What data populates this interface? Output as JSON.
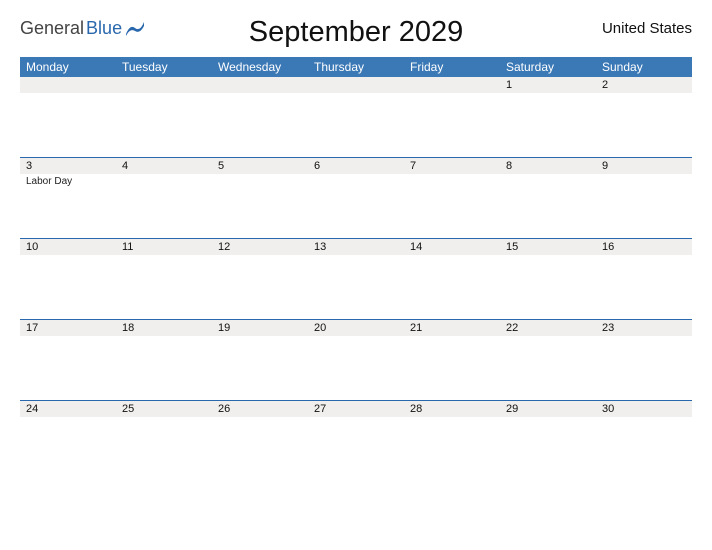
{
  "brand": {
    "part1": "General",
    "part2": "Blue"
  },
  "title": "September 2029",
  "region": "United States",
  "dayNames": [
    "Monday",
    "Tuesday",
    "Wednesday",
    "Thursday",
    "Friday",
    "Saturday",
    "Sunday"
  ],
  "weeks": [
    [
      {
        "date": "",
        "event": ""
      },
      {
        "date": "",
        "event": ""
      },
      {
        "date": "",
        "event": ""
      },
      {
        "date": "",
        "event": ""
      },
      {
        "date": "",
        "event": ""
      },
      {
        "date": "1",
        "event": ""
      },
      {
        "date": "2",
        "event": ""
      }
    ],
    [
      {
        "date": "3",
        "event": "Labor Day"
      },
      {
        "date": "4",
        "event": ""
      },
      {
        "date": "5",
        "event": ""
      },
      {
        "date": "6",
        "event": ""
      },
      {
        "date": "7",
        "event": ""
      },
      {
        "date": "8",
        "event": ""
      },
      {
        "date": "9",
        "event": ""
      }
    ],
    [
      {
        "date": "10",
        "event": ""
      },
      {
        "date": "11",
        "event": ""
      },
      {
        "date": "12",
        "event": ""
      },
      {
        "date": "13",
        "event": ""
      },
      {
        "date": "14",
        "event": ""
      },
      {
        "date": "15",
        "event": ""
      },
      {
        "date": "16",
        "event": ""
      }
    ],
    [
      {
        "date": "17",
        "event": ""
      },
      {
        "date": "18",
        "event": ""
      },
      {
        "date": "19",
        "event": ""
      },
      {
        "date": "20",
        "event": ""
      },
      {
        "date": "21",
        "event": ""
      },
      {
        "date": "22",
        "event": ""
      },
      {
        "date": "23",
        "event": ""
      }
    ],
    [
      {
        "date": "24",
        "event": ""
      },
      {
        "date": "25",
        "event": ""
      },
      {
        "date": "26",
        "event": ""
      },
      {
        "date": "27",
        "event": ""
      },
      {
        "date": "28",
        "event": ""
      },
      {
        "date": "29",
        "event": ""
      },
      {
        "date": "30",
        "event": ""
      }
    ]
  ]
}
